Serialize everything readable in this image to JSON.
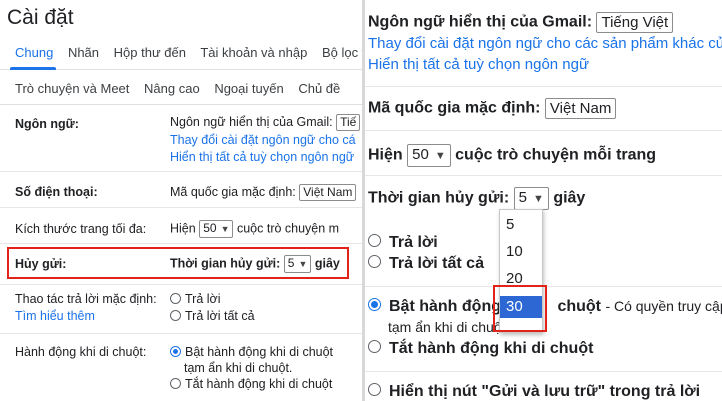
{
  "left": {
    "title": "Cài đặt",
    "tabs_row1": [
      "Chung",
      "Nhãn",
      "Hộp thư đến",
      "Tài khoản và nhập",
      "Bộ lọc và"
    ],
    "tabs_row2": [
      "Trò chuyện và Meet",
      "Nâng cao",
      "Ngoại tuyến",
      "Chủ đề"
    ],
    "language": {
      "label": "Ngôn ngữ:",
      "text": "Ngôn ngữ hiển thị của Gmail:",
      "select_value": "Tiế",
      "link1": "Thay đổi cài đặt ngôn ngữ cho cá",
      "link2": "Hiển thị tất cả tuỳ chọn ngôn ngữ"
    },
    "phone": {
      "label": "Số điện thoại:",
      "text": "Mã quốc gia mặc định:",
      "select_value": "Việt Nam"
    },
    "page_size": {
      "label": "Kích thước trang tối đa:",
      "prefix": "Hiện",
      "select_value": "50",
      "suffix": "cuộc trò chuyện m"
    },
    "undo_send": {
      "label": "Hủy gửi:",
      "text": "Thời gian hủy gửi:",
      "select_value": "5",
      "suffix": "giây"
    },
    "reply_default": {
      "label": "Thao tác trả lời mặc định:",
      "learn_more": "Tìm hiểu thêm",
      "option1": "Trả lời",
      "option2": "Trả lời tất cả"
    },
    "hover": {
      "label": "Hành động khi di chuột:",
      "option1": "Bật hành động khi di chuột",
      "option1_desc": "tạm ẩn khi di chuột.",
      "option2": "Tắt hành động khi di chuột"
    }
  },
  "right": {
    "language": {
      "text": "Ngôn ngữ hiển thị của Gmail:",
      "select_value": "Tiếng Việt",
      "link1": "Thay đổi cài đặt ngôn ngữ cho các sản phẩm khác của",
      "link2": "Hiển thị tất cả tuỳ chọn ngôn ngữ"
    },
    "phone": {
      "text": "Mã quốc gia mặc định:",
      "select_value": "Việt Nam"
    },
    "page_size": {
      "prefix": "Hiện",
      "select_value": "50",
      "suffix": "cuộc trò chuyện mỗi trang"
    },
    "undo_send": {
      "text": "Thời gian hủy gửi:",
      "select_value": "5",
      "suffix": "giây"
    },
    "dropdown_options": [
      "5",
      "10",
      "20",
      "30"
    ],
    "dropdown_highlighted": "30",
    "reply": {
      "option1": "Trả lời",
      "option2": "Trả lời tất cả"
    },
    "hover": {
      "option1": "Bật hành động",
      "option1_tail": "chuột",
      "option1_desc": "- Có quyền truy cập",
      "option1_desc2": "tạm ẩn khi di chuột.",
      "option2": "Tắt hành động khi di chuột"
    },
    "archive": {
      "text": "Hiển thị nút \"Gửi và lưu trữ\" trong trả lời"
    }
  },
  "colors": {
    "accent": "#1a73e8",
    "highlight_box": "#e2231a",
    "dropdown_selected": "#2c67d4"
  }
}
